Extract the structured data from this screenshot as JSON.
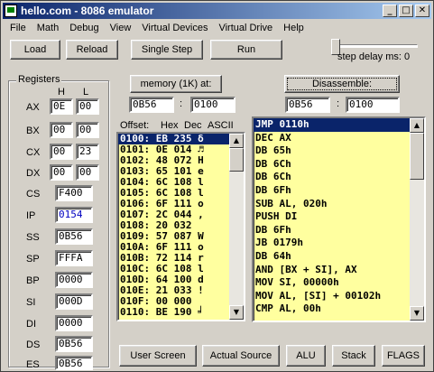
{
  "window": {
    "title": "hello.com - 8086 emulator",
    "minimize": "_",
    "maximize": "□",
    "close": "✕"
  },
  "menu": [
    "File",
    "Math",
    "Debug",
    "View",
    "Virtual Devices",
    "Virtual Drive",
    "Help"
  ],
  "toolbar": {
    "load": "Load",
    "reload": "Reload",
    "single_step": "Single Step",
    "run": "Run",
    "step_delay_label": "step delay ms: 0",
    "step_delay_value": 0
  },
  "registers": {
    "title": "Registers",
    "h_header": "H",
    "l_header": "L",
    "general": [
      {
        "name": "AX",
        "h": "0E",
        "l": "00"
      },
      {
        "name": "BX",
        "h": "00",
        "l": "00"
      },
      {
        "name": "CX",
        "h": "00",
        "l": "23"
      },
      {
        "name": "DX",
        "h": "00",
        "l": "00"
      }
    ],
    "segment": [
      {
        "name": "CS",
        "value": "F400"
      },
      {
        "name": "IP",
        "value": "0154"
      },
      {
        "name": "SS",
        "value": "0B56"
      },
      {
        "name": "SP",
        "value": "FFFA"
      },
      {
        "name": "BP",
        "value": "0000"
      },
      {
        "name": "SI",
        "value": "000D"
      },
      {
        "name": "DI",
        "value": "0000"
      },
      {
        "name": "DS",
        "value": "0B56"
      },
      {
        "name": "ES",
        "value": "0B56"
      }
    ],
    "ip_color": "#0000c0"
  },
  "memory": {
    "button": "memory (1K) at:",
    "segment": "0B56",
    "separator": ":",
    "offset": "0100",
    "headers": {
      "offset": "Offset:",
      "hex": "Hex",
      "dec": "Dec",
      "ascii": "ASCII"
    },
    "rows": [
      "0100: EB 235 δ",
      "0101: 0E 014 ♬",
      "0102: 48 072 H",
      "0103: 65 101 e",
      "0104: 6C 108 l",
      "0105: 6C 108 l",
      "0106: 6F 111 o",
      "0107: 2C 044 ,",
      "0108: 20 032  ",
      "0109: 57 087 W",
      "010A: 6F 111 o",
      "010B: 72 114 r",
      "010C: 6C 108 l",
      "010D: 64 100 d",
      "010E: 21 033 !",
      "010F: 00 000  ",
      "0110: BE 190 ╛"
    ],
    "selected_index": 0
  },
  "disassemble": {
    "button": "Disassemble:",
    "segment": "0B56",
    "separator": ":",
    "offset": "0100",
    "rows": [
      "JMP 0110h",
      "DEC AX",
      "DB 65h",
      "DB 6Ch",
      "DB 6Ch",
      "DB 6Fh",
      "SUB AL, 020h",
      "PUSH DI",
      "DB 6Fh",
      "JB 0179h",
      "DB 64h",
      "AND [BX + SI], AX",
      "MOV SI, 00000h",
      "MOV AL, [SI] + 00102h",
      "CMP AL, 00h"
    ],
    "selected_index": 0
  },
  "bottom_buttons": {
    "user_screen": "User Screen",
    "actual_source": "Actual Source",
    "alu": "ALU",
    "stack": "Stack",
    "flags": "FLAGS"
  },
  "colors": {
    "list_bg": "#ffff9f",
    "selection": "#0a246a",
    "title_start": "#0a246a",
    "title_end": "#a6caf0"
  }
}
